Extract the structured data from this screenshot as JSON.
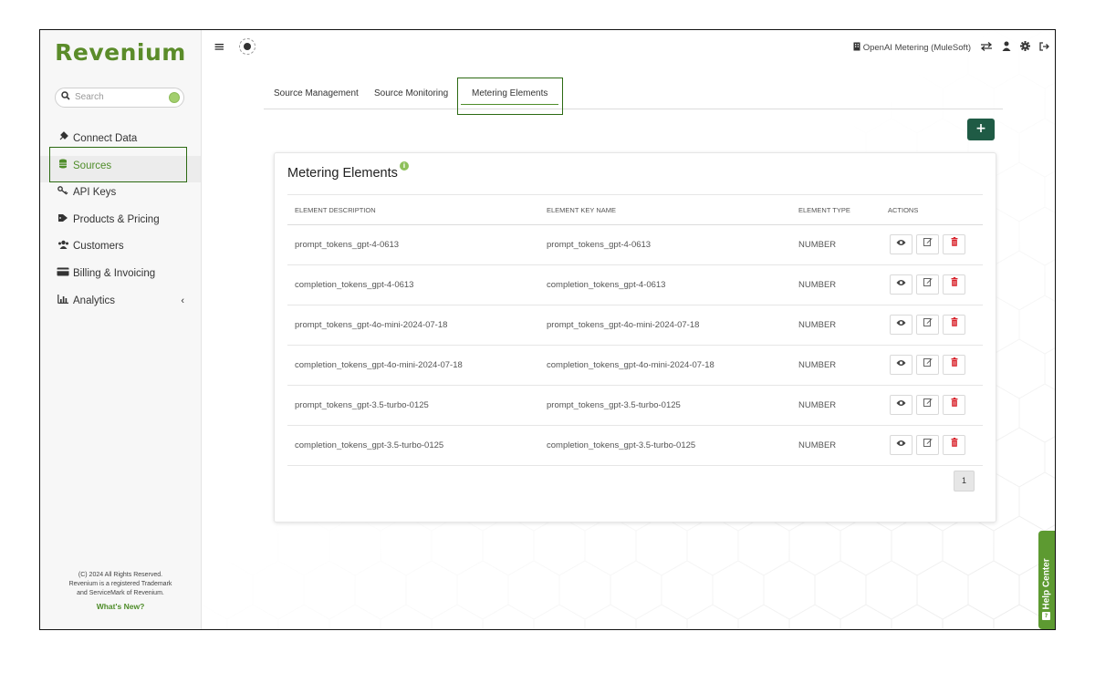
{
  "app": {
    "logo": "Revenium"
  },
  "search": {
    "placeholder": "Search"
  },
  "sidebar": {
    "items": [
      {
        "label": "Connect Data",
        "icon": "plug-icon"
      },
      {
        "label": "Sources",
        "icon": "database-icon",
        "active": true
      },
      {
        "label": "API Keys",
        "icon": "key-icon"
      },
      {
        "label": "Products & Pricing",
        "icon": "tag-icon"
      },
      {
        "label": "Customers",
        "icon": "users-icon"
      },
      {
        "label": "Billing & Invoicing",
        "icon": "credit-card-icon"
      },
      {
        "label": "Analytics",
        "icon": "bar-chart-icon",
        "chevron": "‹"
      }
    ],
    "footer": {
      "line1": "(C) 2024 All Rights Reserved.",
      "line2": "Revenium is a registered Trademark",
      "line3": "and ServiceMark of Revenium.",
      "whats_new": "What's New?"
    }
  },
  "topbar": {
    "menu_icon": "≡",
    "org_name": "OpenAI Metering (MuleSoft)",
    "icons": [
      "building-icon",
      "swap-icon",
      "user-icon",
      "gear-icon",
      "logout-icon"
    ]
  },
  "tabs": [
    {
      "label": "Source Management"
    },
    {
      "label": "Source Monitoring"
    },
    {
      "label": "Metering Elements",
      "active": true
    }
  ],
  "add_button": {
    "label": "+"
  },
  "card": {
    "title": "Metering Elements",
    "info": "i",
    "columns": [
      "ELEMENT DESCRIPTION",
      "ELEMENT KEY NAME",
      "ELEMENT TYPE",
      "ACTIONS"
    ],
    "rows": [
      {
        "description": "prompt_tokens_gpt-4-0613",
        "key": "prompt_tokens_gpt-4-0613",
        "type": "NUMBER"
      },
      {
        "description": "completion_tokens_gpt-4-0613",
        "key": "completion_tokens_gpt-4-0613",
        "type": "NUMBER"
      },
      {
        "description": "prompt_tokens_gpt-4o-mini-2024-07-18",
        "key": "prompt_tokens_gpt-4o-mini-2024-07-18",
        "type": "NUMBER"
      },
      {
        "description": "completion_tokens_gpt-4o-mini-2024-07-18",
        "key": "completion_tokens_gpt-4o-mini-2024-07-18",
        "type": "NUMBER"
      },
      {
        "description": "prompt_tokens_gpt-3.5-turbo-0125",
        "key": "prompt_tokens_gpt-3.5-turbo-0125",
        "type": "NUMBER"
      },
      {
        "description": "completion_tokens_gpt-3.5-turbo-0125",
        "key": "completion_tokens_gpt-3.5-turbo-0125",
        "type": "NUMBER"
      }
    ],
    "actions": {
      "view_icon": "eye-icon",
      "edit_icon": "edit-icon",
      "delete_icon": "trash-icon"
    }
  },
  "pagination": {
    "current": "1"
  },
  "help_center": {
    "label": "Help Center"
  },
  "colors": {
    "brand": "#5b8c2a",
    "accent": "#4f8d2a",
    "add_button": "#1f5b45",
    "delete": "#d8222b",
    "highlight": "#2c6a12"
  }
}
